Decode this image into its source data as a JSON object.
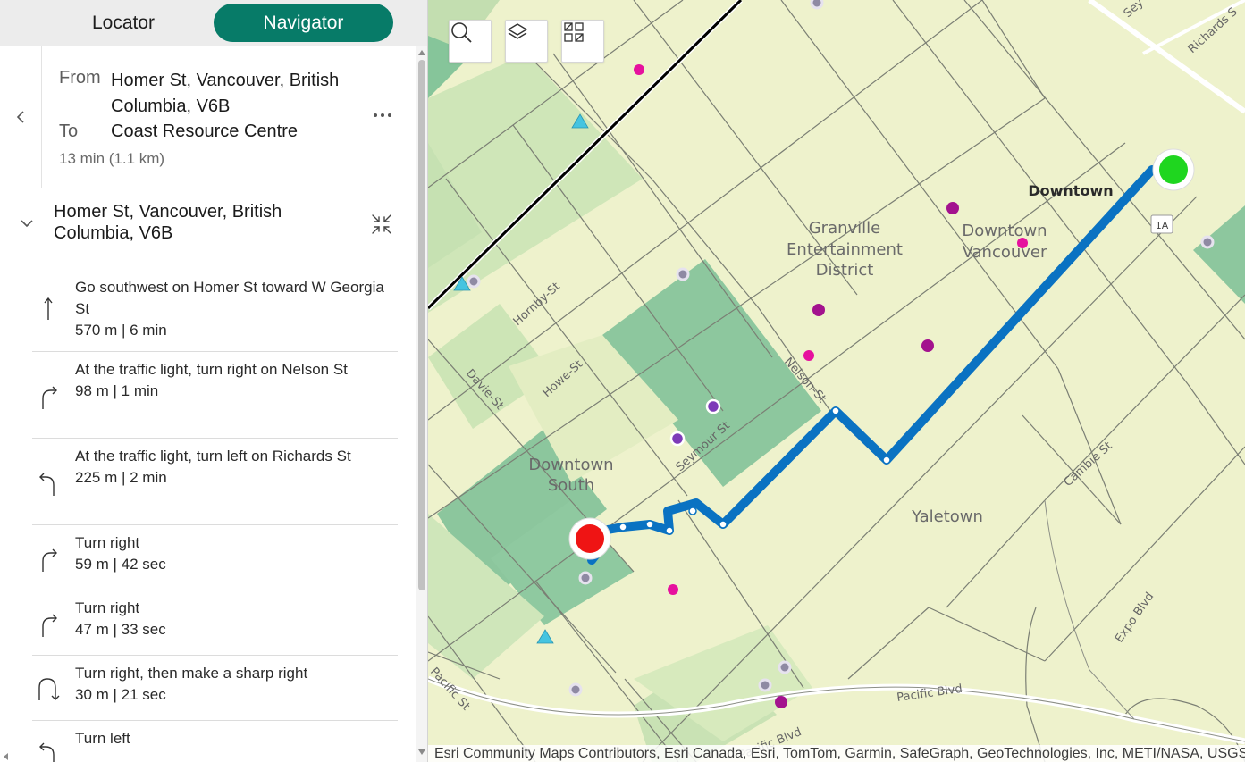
{
  "tabs": {
    "locator": "Locator",
    "navigator": "Navigator"
  },
  "route": {
    "from_label": "From",
    "from_value": "Homer St, Vancouver, British Columbia, V6B",
    "to_label": "To",
    "to_value": "Coast Resource Centre",
    "summary": "13 min (1.1 km)"
  },
  "start": {
    "title": "Homer St, Vancouver, British Columbia, V6B"
  },
  "steps": [
    {
      "text": "Go southwest on Homer St toward W Georgia St",
      "detail": "570 m | 6 min",
      "icon": "straight-arrow-icon"
    },
    {
      "text": "At the traffic light, turn right on Nelson St",
      "detail": "98 m | 1 min",
      "icon": "turn-right-icon"
    },
    {
      "text": "At the traffic light, turn left on Richards St",
      "detail": "225 m | 2 min",
      "icon": "turn-left-icon"
    },
    {
      "text": "Turn right",
      "detail": "59 m | 42 sec",
      "icon": "turn-right-icon"
    },
    {
      "text": "Turn right",
      "detail": "47 m | 33 sec",
      "icon": "turn-right-icon"
    },
    {
      "text": "Turn right, then make a sharp right",
      "detail": "30 m | 21 sec",
      "icon": "sharp-right-icon"
    },
    {
      "text": "Turn left",
      "detail": "",
      "icon": "turn-left-icon"
    }
  ],
  "map": {
    "labels": {
      "downtown": "Downtown",
      "granville_1": "Granville",
      "granville_2": "Entertainment",
      "granville_3": "District",
      "dtvan_1": "Downtown",
      "dtvan_2": "Vancouver",
      "dtsouth_1": "Downtown",
      "dtsouth_2": "South",
      "yaletown": "Yaletown",
      "hornby": "Hornby-St",
      "howe": "Howe-St",
      "davie": "Davie-St",
      "nelson": "Nelson-St",
      "seymour": "Seymour St",
      "cambie": "Cambie St",
      "expo": "Expo Blvd",
      "pacific_blvd": "Pacific Blvd",
      "pacific_blvd_2": "Pacific Blvd",
      "pacific_st": "Pacific St",
      "richards": "Richards S",
      "sey_top": "Sey",
      "shield_1a": "1A"
    },
    "attribution": "Esri Community Maps Contributors, Esri Canada, Esri, TomTom, Garmin, SafeGraph, GeoTechnologies, Inc, METI/NASA, USGS",
    "colors": {
      "route": "#0a72c2",
      "start_marker": "#1fd61f",
      "end_marker": "#ef1414",
      "accent": "#077b68",
      "poi_magenta": "#e6119e",
      "poi_purple": "#a3128e",
      "poi_violet": "#7d3bb8",
      "poi_triangle": "#45c4e0"
    },
    "buttons": [
      "search-icon",
      "layers-icon",
      "basemap-gallery-icon"
    ]
  }
}
